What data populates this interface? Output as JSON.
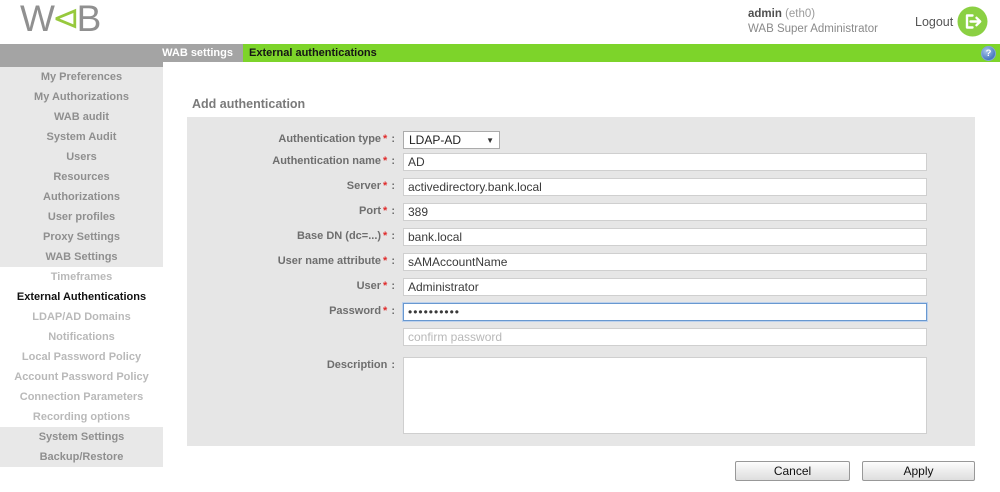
{
  "header": {
    "logo": {
      "left": "W",
      "mid": "⊲",
      "right": "B"
    },
    "user": {
      "name": "admin",
      "interface": "(eth0)",
      "role": "WAB Super Administrator"
    },
    "logout_label": "Logout"
  },
  "tabbar": {
    "parent_tab": "WAB settings",
    "active_tab": "External authentications"
  },
  "icons": {
    "dropdown_arrow": "▼",
    "help": "?",
    "required_marker": "*",
    "separator": ":"
  },
  "sidebar": {
    "main_items": [
      "My Preferences",
      "My Authorizations",
      "WAB audit",
      "System Audit",
      "Users",
      "Resources",
      "Authorizations",
      "User profiles",
      "Proxy Settings",
      "WAB Settings"
    ],
    "sub_items": [
      "Timeframes",
      "External Authentications",
      "LDAP/AD Domains",
      "Notifications",
      "Local Password Policy",
      "Account Password Policy",
      "Connection Parameters",
      "Recording options"
    ],
    "active_sub_item": "External Authentications",
    "bottom_items": [
      "System Settings",
      "Backup/Restore"
    ]
  },
  "form": {
    "title": "Add authentication",
    "fields": [
      {
        "label": "Authentication type",
        "required": true,
        "type": "select",
        "value": "LDAP-AD"
      },
      {
        "label": "Authentication name",
        "required": true,
        "type": "text",
        "value": "AD"
      },
      {
        "label": "Server",
        "required": true,
        "type": "text",
        "value": "activedirectory.bank.local"
      },
      {
        "label": "Port",
        "required": true,
        "type": "text",
        "value": "389"
      },
      {
        "label": "Base DN (dc=...)",
        "required": true,
        "type": "text",
        "value": "bank.local"
      },
      {
        "label": "User name attribute",
        "required": true,
        "type": "text",
        "value": "sAMAccountName"
      },
      {
        "label": "User",
        "required": true,
        "type": "text",
        "value": "Administrator"
      },
      {
        "label": "Password",
        "required": true,
        "type": "password",
        "value": "••••••••••",
        "focused": true
      },
      {
        "label": "",
        "required": false,
        "type": "text",
        "value": "",
        "placeholder": "confirm password"
      },
      {
        "label": "Description",
        "required": false,
        "type": "textarea",
        "value": ""
      }
    ],
    "buttons": {
      "cancel": "Cancel",
      "apply": "Apply"
    }
  },
  "colors": {
    "accent_green": "#7dd42a",
    "logo_green": "#97c93d",
    "tab_gray": "#a4a4a4",
    "panel_gray": "#e6e6e6",
    "required_red": "#e02b2b",
    "focus_blue": "#6898d0"
  }
}
